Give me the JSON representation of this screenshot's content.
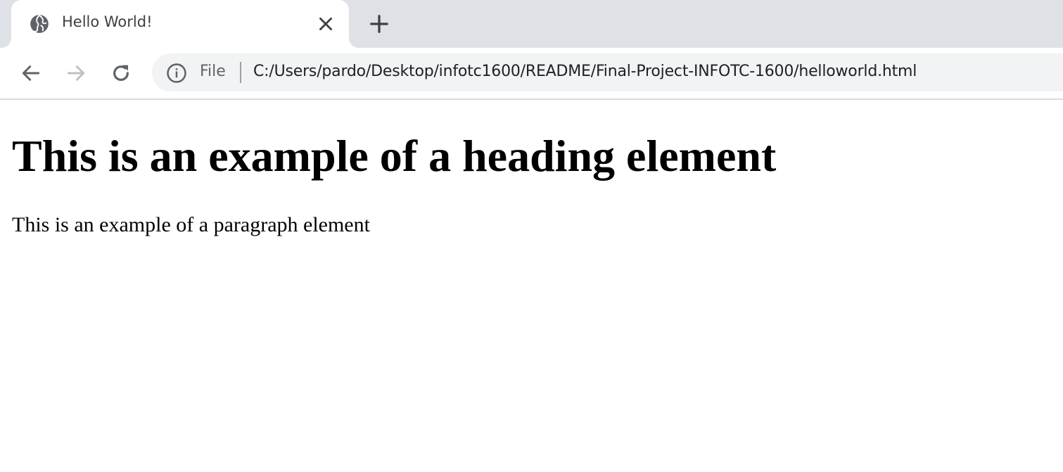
{
  "browser": {
    "tab": {
      "title": "Hello World!",
      "favicon": "globe-icon"
    },
    "toolbar": {
      "address_bar": {
        "scheme_label": "File",
        "url": "C:/Users/pardo/Desktop/infotc1600/README/Final-Project-INFOTC-1600/helloworld.html"
      }
    },
    "colors": {
      "tabstrip_bg": "#dee1e6",
      "omnibox_bg": "#f1f3f4",
      "icon_color": "#5f6368",
      "disabled_icon_color": "#bdc1c6"
    }
  },
  "page": {
    "heading": "This is an example of a heading element",
    "paragraph": "This is an example of a paragraph element"
  }
}
